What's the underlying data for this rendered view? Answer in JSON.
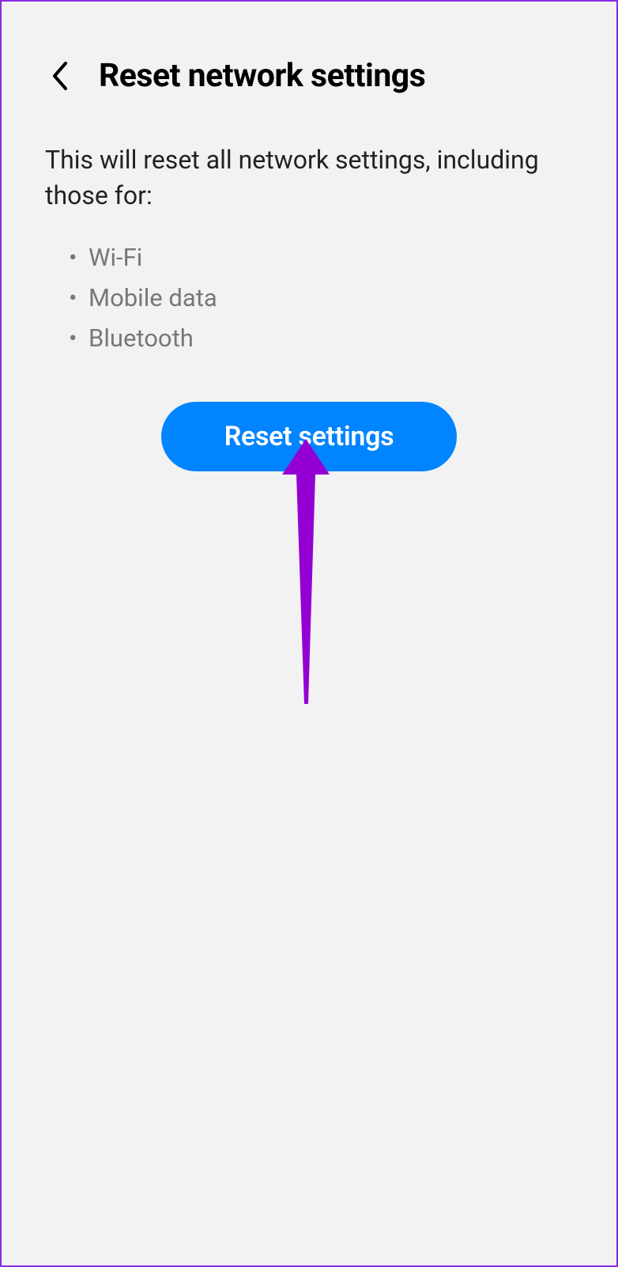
{
  "header": {
    "title": "Reset network settings"
  },
  "description": "This will reset all network settings, including those for:",
  "items": [
    "Wi-Fi",
    "Mobile data",
    "Bluetooth"
  ],
  "button": {
    "label": "Reset settings"
  },
  "colors": {
    "accent": "#0084ff",
    "annotation": "#9400d3"
  }
}
